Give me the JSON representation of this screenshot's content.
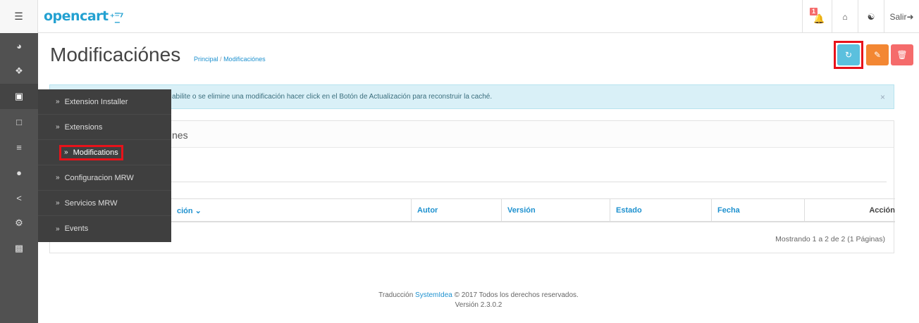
{
  "header": {
    "logo": "opencart",
    "notification_count": "1",
    "logout_label": "Salir"
  },
  "sidebar": {
    "icons": [
      "dashboard-icon",
      "tags-icon",
      "puzzle-icon",
      "desktop-icon",
      "cart-icon",
      "user-icon",
      "share-icon",
      "cog-icon",
      "bar-chart-icon"
    ]
  },
  "dropdown": {
    "items": [
      {
        "label": "Extension Installer"
      },
      {
        "label": "Extensions"
      },
      {
        "label": "Modifications"
      },
      {
        "label": "Configuracion MRW"
      },
      {
        "label": "Servicios MRW"
      },
      {
        "label": "Events"
      }
    ]
  },
  "page": {
    "title": "Modificaciónes",
    "breadcrumb": [
      "Principal",
      "Modificaciónes"
    ],
    "breadcrumb_sep": "/"
  },
  "alert": {
    "text": "abilite o se elimine una modificación hacer click en el Botón de Actualización para reconstruir la caché.",
    "close": "×"
  },
  "panel": {
    "title": "nes"
  },
  "table": {
    "columns": [
      "ción ⌄",
      "Autor",
      "Versión",
      "Estado",
      "Fecha",
      "Acción"
    ]
  },
  "pagination": {
    "info": "Mostrando 1 a 2 de 2 (1 Páginas)"
  },
  "footer": {
    "prefix": "Traducción",
    "link": "SystemIdea",
    "suffix": "© 2017 Todos los derechos reservados.",
    "version": "Versión 2.3.0.2"
  },
  "colors": {
    "accent": "#1e91cf",
    "refresh": "#5bc0de",
    "clear": "#f38733",
    "delete": "#f56b6b",
    "highlight": "#e8121a"
  }
}
